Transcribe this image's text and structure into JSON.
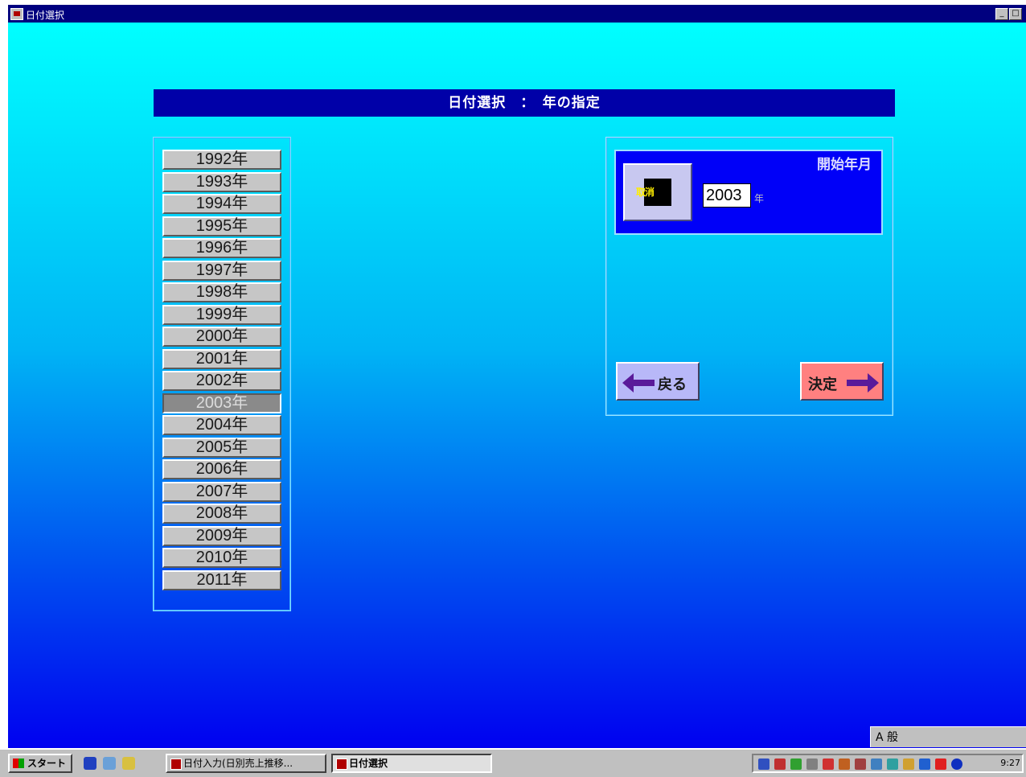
{
  "window": {
    "title": "日付選択"
  },
  "header": {
    "title": "日付選択　：　年の指定"
  },
  "year_list": {
    "items": [
      "1992年",
      "1993年",
      "1994年",
      "1995年",
      "1996年",
      "1997年",
      "1998年",
      "1999年",
      "2000年",
      "2001年",
      "2002年",
      "2003年",
      "2004年",
      "2005年",
      "2006年",
      "2007年",
      "2008年",
      "2009年",
      "2010年",
      "2011年"
    ],
    "selected": "2003年"
  },
  "start_panel": {
    "label": "開始年月",
    "clear_label": "取消",
    "year_value": "2003",
    "year_suffix": "年"
  },
  "buttons": {
    "back": "戻る",
    "decide": "決定"
  },
  "ime": {
    "text": "A 般"
  },
  "taskbar": {
    "start": "スタート",
    "tasks": [
      "日付入力(日別売上推移...",
      "日付選択"
    ],
    "clock": "9:27"
  },
  "colors": {
    "banner": "#0000a8",
    "selected_item": "#8a8a8a",
    "decide": "#ff8080",
    "back": "#b8b8f8"
  }
}
